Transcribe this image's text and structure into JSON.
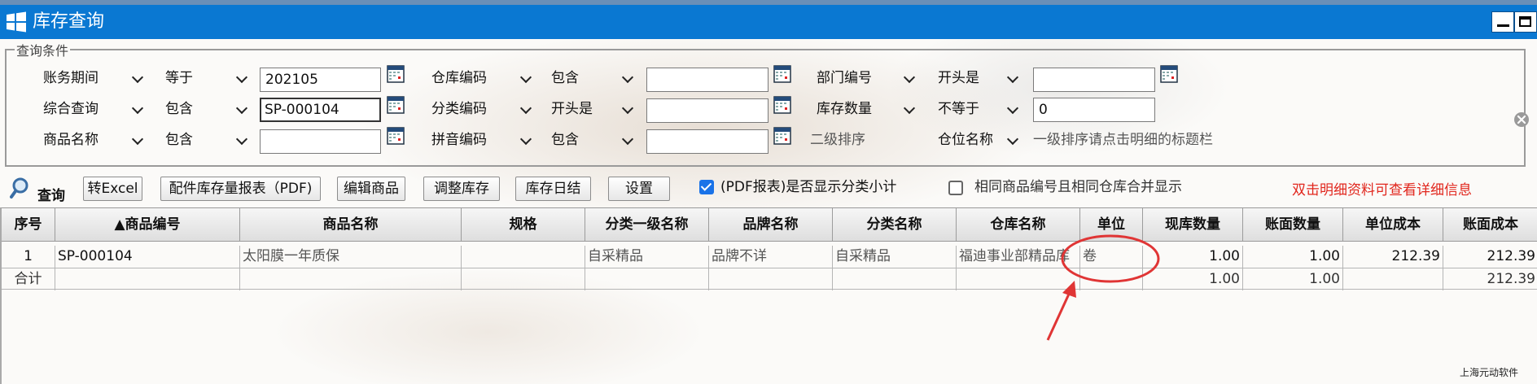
{
  "window": {
    "title": "库存查询",
    "icon": "windows-logo-icon"
  },
  "conditions": {
    "legend": "查询条件",
    "rows": [
      {
        "field1": "账务期间",
        "op1": "等于",
        "value1": "202105",
        "field2": "仓库编码",
        "op2": "包含",
        "value2": "",
        "field3": "部门编号",
        "op3": "开头是",
        "value3": ""
      },
      {
        "field1": "综合查询",
        "op1": "包含",
        "value1": "SP-000104",
        "field2": "分类编码",
        "op2": "开头是",
        "value2": "",
        "field3": "库存数量",
        "op3": "不等于",
        "value3": "0"
      },
      {
        "field1": "商品名称",
        "op1": "包含",
        "value1": "",
        "field2": "拼音编码",
        "op2": "包含",
        "value2": "",
        "label3": "二级排序",
        "sort_field": "仓位名称",
        "sort_hint": "一级排序请点击明细的标题栏"
      }
    ]
  },
  "toolbar": {
    "query": "查询",
    "excel": "转Excel",
    "report_pdf": "配件库存量报表（PDF)",
    "edit_goods": "编辑商品",
    "adjust_stock": "调整库存",
    "daily_close": "库存日结",
    "settings": "设置",
    "pdf_subtotal_label": "(PDF报表)是否显示分类小计",
    "pdf_subtotal_checked": true,
    "merge_label": "相同商品编号且相同仓库合并显示",
    "merge_checked": false,
    "hint": "双击明细资料可查看详细信息",
    "hint_color": "#e1261d"
  },
  "table": {
    "columns": [
      "序号",
      "▲商品编号",
      "商品名称",
      "规格",
      "分类一级名称",
      "品牌名称",
      "分类名称",
      "仓库名称",
      "单位",
      "现库数量",
      "账面数量",
      "单位成本",
      "账面成本"
    ],
    "rows": [
      [
        "1",
        "SP-000104",
        "太阳膜一年质保",
        "",
        "自采精品",
        "品牌不详",
        "自采精品",
        "福迪事业部精品库",
        "卷",
        "1.00",
        "1.00",
        "212.39",
        "212.39"
      ]
    ],
    "total": [
      "合计",
      "",
      "",
      "",
      "",
      "",
      "",
      "",
      "",
      "1.00",
      "1.00",
      "",
      "212.39"
    ]
  },
  "footer": "上海元动软件",
  "colors": {
    "titlebar": "#0a78d2",
    "annotation": "#e03535"
  }
}
